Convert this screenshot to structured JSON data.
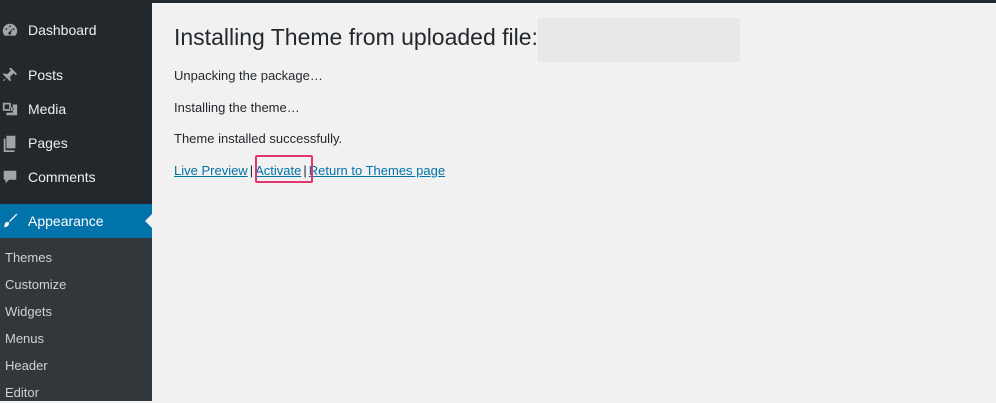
{
  "sidebar": {
    "items": [
      {
        "label": "Dashboard",
        "icon": "dashboard-icon"
      },
      {
        "label": "Posts",
        "icon": "pin-icon"
      },
      {
        "label": "Media",
        "icon": "media-icon"
      },
      {
        "label": "Pages",
        "icon": "pages-icon"
      },
      {
        "label": "Comments",
        "icon": "comments-icon"
      },
      {
        "label": "Appearance",
        "icon": "paintbrush-icon",
        "active": true
      }
    ],
    "submenu": [
      {
        "label": "Themes"
      },
      {
        "label": "Customize"
      },
      {
        "label": "Widgets"
      },
      {
        "label": "Menus"
      },
      {
        "label": "Header"
      },
      {
        "label": "Editor"
      }
    ]
  },
  "main": {
    "title": "Installing Theme from uploaded file:",
    "status_lines": [
      "Unpacking the package…",
      "Installing the theme…",
      "Theme installed successfully."
    ],
    "actions": {
      "live_preview": "Live Preview",
      "separator": "|",
      "activate": "Activate",
      "return_link": "Return to Themes page"
    }
  },
  "colors": {
    "sidebar_bg": "#23282d",
    "submenu_bg": "#32373c",
    "active_bg": "#0073aa",
    "link": "#0073aa",
    "highlight": "#e0356d",
    "page_bg": "#f1f1f1"
  }
}
